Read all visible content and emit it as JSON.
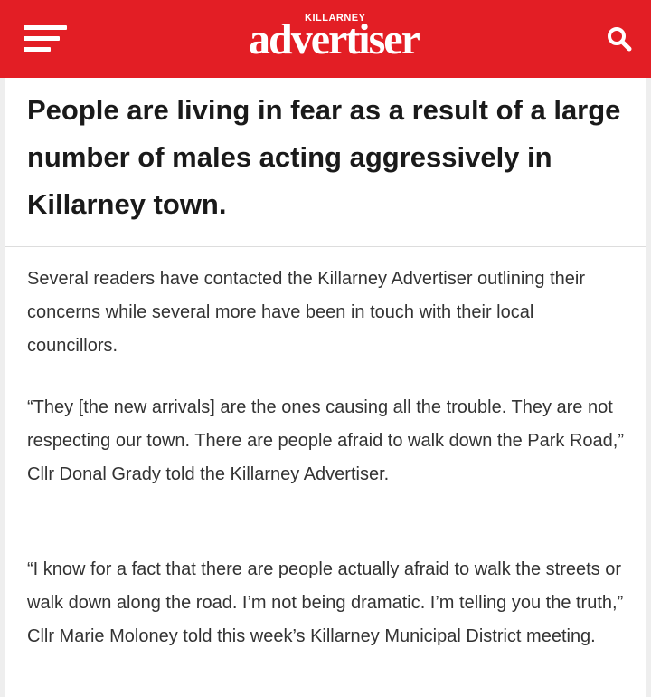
{
  "header": {
    "logo_top": "KILLARNEY",
    "logo_main": "advertiser",
    "accent_color": "#e31e25",
    "menu_icon": "hamburger-menu-icon",
    "search_icon": "search-icon"
  },
  "article": {
    "headline": "People are living in fear as a result of a large number of males acting aggressively in Killarney town.",
    "paragraphs": [
      "Several readers have contacted the Killarney Advertiser outlining their concerns while several more have been in touch with their local councillors.",
      "“They [the new arrivals] are the ones causing all the trouble. They are not respecting our town. There are people afraid to walk down the Park Road,” Cllr Donal Grady told the Killarney Advertiser.",
      "“I know for a fact that there are people actually afraid to walk the streets or walk down along the road. I’m not being dramatic. I’m telling you the truth,” Cllr Marie Moloney told this week’s Killarney Municipal District meeting."
    ]
  }
}
